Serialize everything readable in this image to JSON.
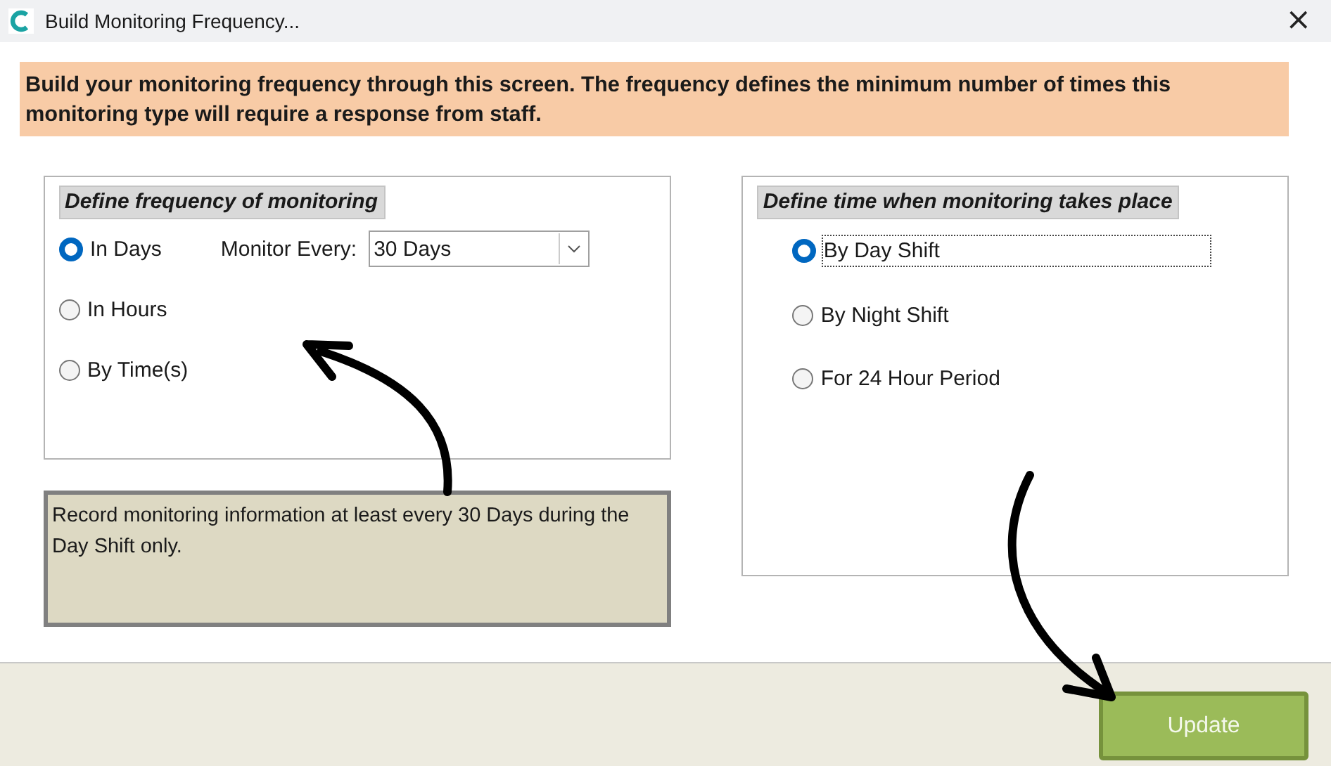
{
  "window": {
    "title": "Build Monitoring Frequency...",
    "close": "×"
  },
  "banner": "Build your monitoring frequency through this screen.  The frequency defines the minimum number of times this monitoring type will require a response from staff.",
  "frequency_group": {
    "title": "Define frequency of monitoring",
    "options": [
      {
        "label": "In Days",
        "selected": true
      },
      {
        "label": "In Hours",
        "selected": false
      },
      {
        "label": "By Time(s)",
        "selected": false
      }
    ],
    "monitor_every": {
      "label": "Monitor Every:",
      "value": "30 Days"
    }
  },
  "summary": "Record monitoring information at least every 30 Days during the Day Shift only.",
  "time_group": {
    "title": "Define time when monitoring takes place",
    "options": [
      {
        "label": "By Day Shift",
        "selected": true,
        "focused": true
      },
      {
        "label": "By Night Shift",
        "selected": false,
        "focused": false
      },
      {
        "label": "For 24 Hour Period",
        "selected": false,
        "focused": false
      }
    ]
  },
  "buttons": [
    {
      "label": "Update"
    }
  ]
}
